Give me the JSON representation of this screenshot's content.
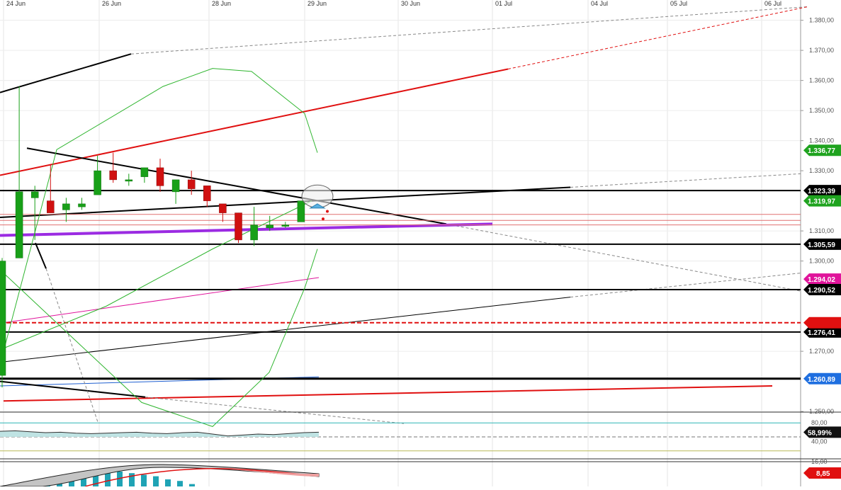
{
  "chart_data": {
    "type": "candlestick",
    "x_dates": [
      "24 Jun",
      "26 Jun",
      "28 Jun",
      "29 Jun",
      "30 Jun",
      "01 Jul",
      "04 Jul",
      "05 Jul",
      "06 Jul"
    ],
    "y_ticks": [
      "1.380,00",
      "1.370,00",
      "1.360,00",
      "1.350,00",
      "1.340,00",
      "1.330,00",
      "1.310,00",
      "1.300,00",
      "1.270,00",
      "1.250,00"
    ],
    "ylim": [
      1.245,
      1.382
    ],
    "candles": [
      {
        "o": 1.262,
        "h": 1.301,
        "l": 1.258,
        "c": 1.3
      },
      {
        "o": 1.301,
        "h": 1.358,
        "l": 1.301,
        "c": 1.323
      },
      {
        "o": 1.321,
        "h": 1.325,
        "l": 1.307,
        "c": 1.323
      },
      {
        "o": 1.32,
        "h": 1.332,
        "l": 1.316,
        "c": 1.316
      },
      {
        "o": 1.317,
        "h": 1.321,
        "l": 1.313,
        "c": 1.319
      },
      {
        "o": 1.318,
        "h": 1.321,
        "l": 1.317,
        "c": 1.319
      },
      {
        "o": 1.322,
        "h": 1.335,
        "l": 1.322,
        "c": 1.33
      },
      {
        "o": 1.33,
        "h": 1.336,
        "l": 1.326,
        "c": 1.327
      },
      {
        "o": 1.327,
        "h": 1.329,
        "l": 1.325,
        "c": 1.327
      },
      {
        "o": 1.328,
        "h": 1.331,
        "l": 1.326,
        "c": 1.331
      },
      {
        "o": 1.331,
        "h": 1.334,
        "l": 1.323,
        "c": 1.325
      },
      {
        "o": 1.323,
        "h": 1.327,
        "l": 1.319,
        "c": 1.327
      },
      {
        "o": 1.327,
        "h": 1.33,
        "l": 1.322,
        "c": 1.324
      },
      {
        "o": 1.325,
        "h": 1.325,
        "l": 1.318,
        "c": 1.32
      },
      {
        "o": 1.319,
        "h": 1.319,
        "l": 1.313,
        "c": 1.316
      },
      {
        "o": 1.316,
        "h": 1.316,
        "l": 1.306,
        "c": 1.307
      },
      {
        "o": 1.307,
        "h": 1.318,
        "l": 1.305,
        "c": 1.312
      },
      {
        "o": 1.311,
        "h": 1.315,
        "l": 1.31,
        "c": 1.312
      },
      {
        "o": 1.312,
        "h": 1.313,
        "l": 1.311,
        "c": 1.312
      },
      {
        "o": 1.313,
        "h": 1.32,
        "l": 1.313,
        "c": 1.32
      }
    ],
    "price_labels": [
      {
        "text": "1.336,77",
        "value": 1.3368,
        "color": "#1fa31f"
      },
      {
        "text": "1.323,39",
        "value": 1.3234,
        "color": "#000000"
      },
      {
        "text": "1.319,97",
        "value": 1.32,
        "color": "#1fa31f"
      },
      {
        "text": "1.305,59",
        "value": 1.3056,
        "color": "#000000"
      },
      {
        "text": "1.294,02",
        "value": 1.294,
        "color": "#e0149b"
      },
      {
        "text": "1.290,52",
        "value": 1.2905,
        "color": "#000000"
      },
      {
        "text": "1.276,41",
        "value": 1.2764,
        "color": "#000000"
      },
      {
        "text": "1.260,89",
        "value": 1.2609,
        "color": "#1f6fe0"
      }
    ],
    "horizontal_levels": [
      1.3234,
      1.3056,
      1.2905,
      1.2764,
      1.2609
    ],
    "dashed_red_level": 1.2795,
    "bollinger_upper": [
      [
        5,
        1.27
      ],
      [
        80,
        1.337
      ],
      [
        230,
        1.358
      ],
      [
        300,
        1.364
      ],
      [
        355,
        1.363
      ],
      [
        430,
        1.349
      ],
      [
        448,
        1.336
      ]
    ],
    "bollinger_lower": [
      [
        5,
        1.296
      ],
      [
        200,
        1.253
      ],
      [
        300,
        1.245
      ],
      [
        380,
        1.263
      ],
      [
        430,
        1.291
      ],
      [
        448,
        1.304
      ]
    ],
    "bollinger_mid": [
      [
        5,
        1.271
      ],
      [
        150,
        1.285
      ],
      [
        300,
        1.304
      ],
      [
        440,
        1.32
      ]
    ],
    "rsi": {
      "ticks": [
        "80,00",
        "40,00"
      ],
      "value_label": "58,99%",
      "values": [
        62,
        63,
        61,
        59,
        60,
        58,
        57,
        58,
        59,
        60,
        58,
        57,
        59,
        60,
        56,
        52,
        54,
        56,
        55,
        57,
        59,
        60
      ]
    },
    "macd": {
      "ticks": [
        "16,00"
      ],
      "value_label": "8,85",
      "histogram": [
        4,
        6,
        8,
        10,
        12,
        13,
        14,
        14,
        15,
        15,
        14,
        13,
        12,
        10,
        9,
        7
      ]
    }
  }
}
